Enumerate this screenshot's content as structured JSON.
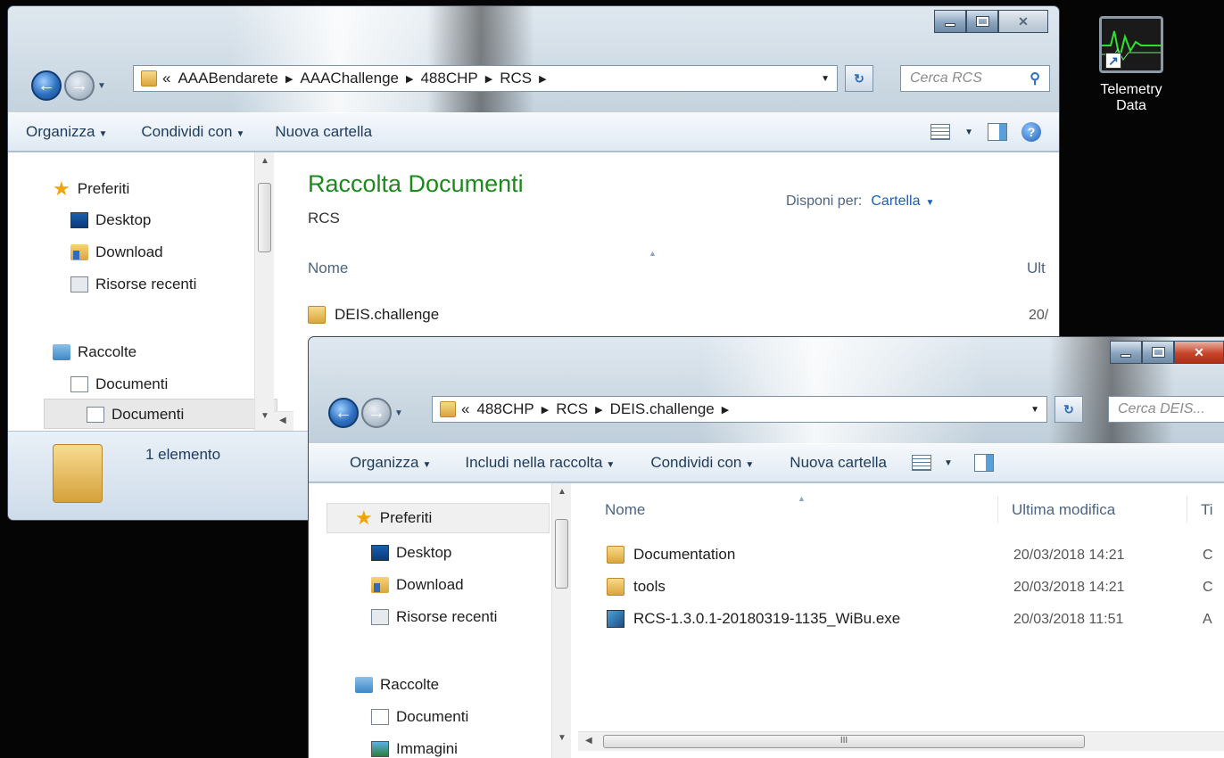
{
  "desktop": {
    "icon_label_line1": "Telemetry",
    "icon_label_line2": "Data"
  },
  "window_back": {
    "address": {
      "prefix": "«",
      "crumbs": [
        "AAABendarete",
        "AAAChallenge",
        "488CHP",
        "RCS"
      ]
    },
    "search_placeholder": "Cerca RCS",
    "toolbar": {
      "organize": "Organizza",
      "share": "Condividi con",
      "new_folder": "Nuova cartella"
    },
    "nav": {
      "favorites": "Preferiti",
      "desktop": "Desktop",
      "download": "Download",
      "recent": "Risorse recenti",
      "libraries": "Raccolte",
      "documents": "Documenti",
      "documents_sub": "Documenti"
    },
    "library_title": "Raccolta Documenti",
    "library_subtitle": "RCS",
    "arrange_label": "Disponi per:",
    "arrange_value": "Cartella",
    "columns": {
      "name": "Nome",
      "modified": "Ult"
    },
    "files": [
      {
        "name": "DEIS.challenge",
        "modified": "20/"
      }
    ],
    "status": "1 elemento"
  },
  "window_front": {
    "address": {
      "prefix": "«",
      "crumbs": [
        "488CHP",
        "RCS",
        "DEIS.challenge"
      ]
    },
    "search_placeholder": "Cerca DEIS...",
    "toolbar": {
      "organize": "Organizza",
      "include": "Includi nella raccolta",
      "share": "Condividi con",
      "new_folder": "Nuova cartella"
    },
    "nav": {
      "favorites": "Preferiti",
      "desktop": "Desktop",
      "download": "Download",
      "recent": "Risorse recenti",
      "libraries": "Raccolte",
      "documents": "Documenti",
      "images": "Immagini"
    },
    "columns": {
      "name": "Nome",
      "modified": "Ultima modifica",
      "type": "Ti"
    },
    "files": [
      {
        "name": "Documentation",
        "modified": "20/03/2018 14:21",
        "type": "C",
        "kind": "folder"
      },
      {
        "name": "tools",
        "modified": "20/03/2018 14:21",
        "type": "C",
        "kind": "folder"
      },
      {
        "name": "RCS-1.3.0.1-20180319-1135_WiBu.exe",
        "modified": "20/03/2018 11:51",
        "type": "A",
        "kind": "exe"
      }
    ],
    "hscroll_grip": "III"
  }
}
